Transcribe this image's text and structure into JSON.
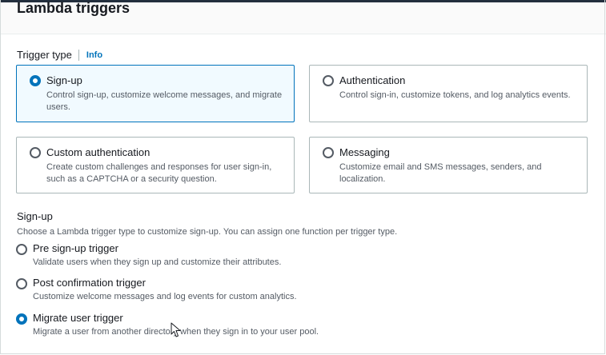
{
  "header": {
    "title": "Lambda triggers"
  },
  "trigger_type": {
    "label": "Trigger type",
    "info_link": "Info",
    "tiles": [
      {
        "title": "Sign-up",
        "desc": "Control sign-up, customize welcome messages, and migrate users.",
        "selected": true
      },
      {
        "title": "Authentication",
        "desc": "Control sign-in, customize tokens, and log analytics events.",
        "selected": false
      },
      {
        "title": "Custom authentication",
        "desc": "Create custom challenges and responses for user sign-in, such as a CAPTCHA or a security question.",
        "selected": false
      },
      {
        "title": "Messaging",
        "desc": "Customize email and SMS messages, senders, and localization.",
        "selected": false
      }
    ]
  },
  "signup": {
    "title": "Sign-up",
    "desc": "Choose a Lambda trigger type to customize sign-up. You can assign one function per trigger type.",
    "options": [
      {
        "title": "Pre sign-up trigger",
        "desc": "Validate users when they sign up and customize their attributes.",
        "selected": false
      },
      {
        "title": "Post confirmation trigger",
        "desc": "Customize welcome messages and log events for custom analytics.",
        "selected": false
      },
      {
        "title": "Migrate user trigger",
        "desc": "Migrate a user from another directory when they sign in to your user pool.",
        "selected": true
      }
    ]
  },
  "colors": {
    "accent": "#0073bb",
    "selected_bg": "#f1faff",
    "border": "#aab7b8"
  },
  "icons": {
    "cursor": "mouse-pointer-icon"
  }
}
